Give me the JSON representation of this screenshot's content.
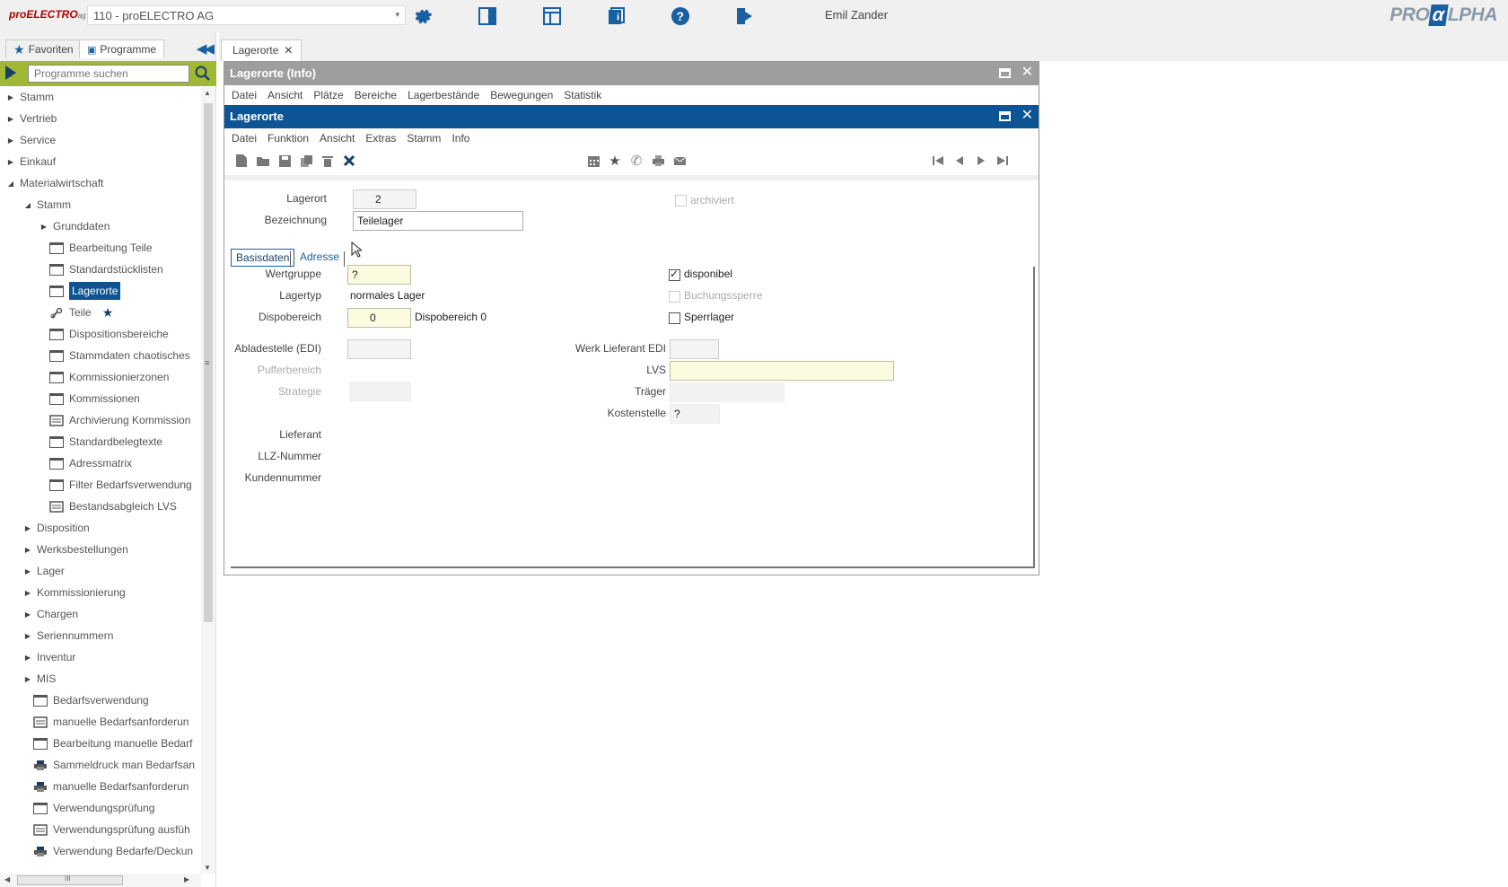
{
  "topbar": {
    "brand": "proELECTRO",
    "brand_suffix": "ag",
    "company": "110 - proELECTRO AG",
    "user": "Emil Zander",
    "logo_left": "PRO",
    "logo_mid": "α",
    "logo_right": "LPHA",
    "icons": [
      "gear-icon",
      "panel-icon",
      "layout-icon",
      "info-book-icon",
      "help-icon",
      "logout-icon"
    ],
    "accent": "#1a5fa0"
  },
  "leftpanel": {
    "tab_favorites": "Favoriten",
    "tab_programs": "Programme",
    "search_placeholder": "Programme suchen",
    "tree": [
      {
        "label": "Stamm",
        "level": 0,
        "toggle": "collapsed"
      },
      {
        "label": "Vertrieb",
        "level": 0,
        "toggle": "collapsed"
      },
      {
        "label": "Service",
        "level": 0,
        "toggle": "collapsed"
      },
      {
        "label": "Einkauf",
        "level": 0,
        "toggle": "collapsed"
      },
      {
        "label": "Materialwirtschaft",
        "level": 0,
        "toggle": "expanded"
      },
      {
        "label": "Stamm",
        "level": 1,
        "toggle": "expanded"
      },
      {
        "label": "Grunddaten",
        "level": 2,
        "toggle": "collapsed"
      },
      {
        "label": "Bearbeitung Teile",
        "level": 2,
        "icon": "window"
      },
      {
        "label": "Standardstücklisten",
        "level": 2,
        "icon": "window"
      },
      {
        "label": "Lagerorte",
        "level": 2,
        "icon": "window",
        "selected": true
      },
      {
        "label": "Teile",
        "level": 2,
        "icon": "tool",
        "star": true
      },
      {
        "label": "Dispositionsbereiche",
        "level": 2,
        "icon": "window"
      },
      {
        "label": "Stammdaten chaotisches",
        "level": 2,
        "icon": "window"
      },
      {
        "label": "Kommissionierzonen",
        "level": 2,
        "icon": "window"
      },
      {
        "label": "Kommissionen",
        "level": 2,
        "icon": "window"
      },
      {
        "label": "Archivierung Kommission",
        "level": 2,
        "icon": "report"
      },
      {
        "label": "Standardbelegtexte",
        "level": 2,
        "icon": "window"
      },
      {
        "label": "Adressmatrix",
        "level": 2,
        "icon": "window"
      },
      {
        "label": "Filter Bedarfsverwendung",
        "level": 2,
        "icon": "window"
      },
      {
        "label": "Bestandsabgleich LVS",
        "level": 2,
        "icon": "report"
      },
      {
        "label": "Disposition",
        "level": 1,
        "toggle": "collapsed"
      },
      {
        "label": "Werksbestellungen",
        "level": 1,
        "toggle": "collapsed"
      },
      {
        "label": "Lager",
        "level": 1,
        "toggle": "collapsed"
      },
      {
        "label": "Kommissionierung",
        "level": 1,
        "toggle": "collapsed"
      },
      {
        "label": "Chargen",
        "level": 1,
        "toggle": "collapsed"
      },
      {
        "label": "Seriennummern",
        "level": 1,
        "toggle": "collapsed"
      },
      {
        "label": "Inventur",
        "level": 1,
        "toggle": "collapsed"
      },
      {
        "label": "MIS",
        "level": 1,
        "toggle": "collapsed"
      },
      {
        "label": "Bedarfsverwendung",
        "level": 1,
        "icon": "window"
      },
      {
        "label": "manuelle Bedarfsanforderun",
        "level": 1,
        "icon": "report"
      },
      {
        "label": "Bearbeitung manuelle Bedarf",
        "level": 1,
        "icon": "window"
      },
      {
        "label": "Sammeldruck man Bedarfsan",
        "level": 1,
        "icon": "print"
      },
      {
        "label": "manuelle Bedarfsanforderun",
        "level": 1,
        "icon": "print"
      },
      {
        "label": "Verwendungsprüfung",
        "level": 1,
        "icon": "window"
      },
      {
        "label": "Verwendungsprüfung ausfüh",
        "level": 1,
        "icon": "report"
      },
      {
        "label": "Verwendung Bedarfe/Deckun",
        "level": 1,
        "icon": "print"
      }
    ],
    "hscroll_grip": "III"
  },
  "maintab": {
    "label": "Lagerorte",
    "close": "✕"
  },
  "infowin": {
    "title": "Lagerorte (Info)",
    "menu": [
      "Datei",
      "Ansicht",
      "Plätze",
      "Bereiche",
      "Lagerbestände",
      "Bewegungen",
      "Statistik"
    ]
  },
  "mainwin": {
    "title": "Lagerorte",
    "menu": [
      "Datei",
      "Funktion",
      "Ansicht",
      "Extras",
      "Stamm",
      "Info"
    ],
    "toolbar_left": [
      "new-doc-icon",
      "open-folder-icon",
      "save-icon",
      "copy-icon",
      "delete-icon",
      "cancel-icon"
    ],
    "toolbar_mid": [
      "calendar-icon",
      "star-icon",
      "phone-icon",
      "print-icon",
      "mail-icon"
    ],
    "toolbar_nav": [
      "first-record-icon",
      "prev-record-icon",
      "next-record-icon",
      "last-record-icon"
    ],
    "header": {
      "lagerort_label": "Lagerort",
      "lagerort_value": "2",
      "bezeichnung_label": "Bezeichnung",
      "bezeichnung_value": "Teilelager",
      "archiviert_label": "archiviert"
    },
    "tabs": [
      "Basisdaten",
      "Adresse"
    ],
    "form": {
      "wertgruppe_label": "Wertgruppe",
      "wertgruppe_value": "?",
      "lagertyp_label": "Lagertyp",
      "lagertyp_value": "normales Lager",
      "dispobereich_label": "Dispobereich",
      "dispobereich_value": "0",
      "dispobereich_desc": "Dispobereich 0",
      "abladestelle_label": "Abladestelle (EDI)",
      "abladestelle_value": "",
      "pufferbereich_label": "Pufferbereich",
      "strategie_label": "Strategie",
      "lieferant_label": "Lieferant",
      "llz_label": "LLZ-Nummer",
      "kundennummer_label": "Kundennummer",
      "disponibel_label": "disponibel",
      "disponibel_checked": true,
      "buchungssperre_label": "Buchungssperre",
      "sperrlager_label": "Sperrlager",
      "sperrlager_checked": false,
      "werk_lieferant_label": "Werk Lieferant EDI",
      "werk_lieferant_value": "",
      "lvs_label": "LVS",
      "lvs_value": "",
      "traeger_label": "Träger",
      "traeger_value": "",
      "kostenstelle_label": "Kostenstelle",
      "kostenstelle_value": "?"
    }
  },
  "colors": {
    "titlebar_info": "#9e9e9e",
    "titlebar_main": "#0d5494",
    "program_bar": "#a0b833",
    "field_yellow": "#fbfbe0"
  }
}
